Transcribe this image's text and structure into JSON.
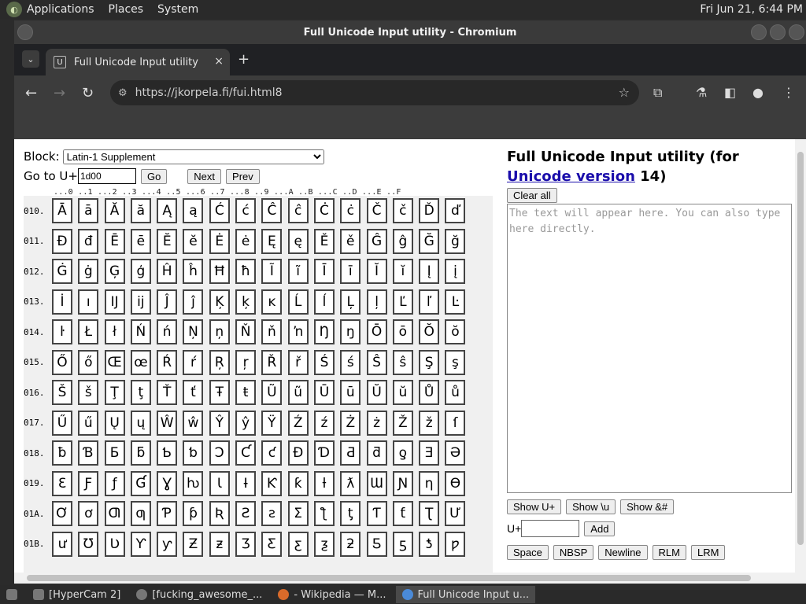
{
  "sysbar": {
    "menus": [
      "Applications",
      "Places",
      "System"
    ],
    "clock": "Fri Jun 21,  6:44 PM"
  },
  "window": {
    "title": "Full Unicode Input utility - Chromium"
  },
  "tab": {
    "title": "Full Unicode Input utility",
    "close": "×",
    "new": "+"
  },
  "omnibox": {
    "url": "https://jkorpela.fi/fui.html8"
  },
  "controls": {
    "block_label": "Block:",
    "block_selected": "Latin-1 Supplement",
    "goto_label": "Go to U+",
    "goto_value": "1d00",
    "go_btn": "Go",
    "next_btn": "Next",
    "prev_btn": "Prev"
  },
  "ruler": "...0 ..1 ...2 ..3 ...4 ..5 ...6 ..7 ...8 ..9 ...A ..B ...C ..D ...E ..F",
  "grid": {
    "rows": [
      {
        "label": "010.",
        "chars": [
          "Ā",
          "ā",
          "Ă",
          "ă",
          "Ą",
          "ą",
          "Ć",
          "ć",
          "Ĉ",
          "ĉ",
          "Ċ",
          "ċ",
          "Č",
          "č",
          "Ď",
          "ď"
        ]
      },
      {
        "label": "011.",
        "chars": [
          "Đ",
          "đ",
          "Ē",
          "ē",
          "Ĕ",
          "ĕ",
          "Ė",
          "ė",
          "Ę",
          "ę",
          "Ě",
          "ě",
          "Ĝ",
          "ĝ",
          "Ğ",
          "ğ"
        ]
      },
      {
        "label": "012.",
        "chars": [
          "Ġ",
          "ġ",
          "Ģ",
          "ģ",
          "Ĥ",
          "ĥ",
          "Ħ",
          "ħ",
          "Ĩ",
          "ĩ",
          "Ī",
          "ī",
          "Ĭ",
          "ĭ",
          "Į",
          "į"
        ]
      },
      {
        "label": "013.",
        "chars": [
          "İ",
          "ı",
          "Ĳ",
          "ĳ",
          "Ĵ",
          "ĵ",
          "Ķ",
          "ķ",
          "ĸ",
          "Ĺ",
          "ĺ",
          "Ļ",
          "ļ",
          "Ľ",
          "ľ",
          "Ŀ"
        ]
      },
      {
        "label": "014.",
        "chars": [
          "ŀ",
          "Ł",
          "ł",
          "Ń",
          "ń",
          "Ņ",
          "ņ",
          "Ň",
          "ň",
          "ŉ",
          "Ŋ",
          "ŋ",
          "Ō",
          "ō",
          "Ŏ",
          "ŏ"
        ]
      },
      {
        "label": "015.",
        "chars": [
          "Ő",
          "ő",
          "Œ",
          "œ",
          "Ŕ",
          "ŕ",
          "Ŗ",
          "ŗ",
          "Ř",
          "ř",
          "Ś",
          "ś",
          "Ŝ",
          "ŝ",
          "Ş",
          "ş"
        ]
      },
      {
        "label": "016.",
        "chars": [
          "Š",
          "š",
          "Ţ",
          "ţ",
          "Ť",
          "ť",
          "Ŧ",
          "ŧ",
          "Ũ",
          "ũ",
          "Ū",
          "ū",
          "Ŭ",
          "ŭ",
          "Ů",
          "ů"
        ]
      },
      {
        "label": "017.",
        "chars": [
          "Ű",
          "ű",
          "Ų",
          "ų",
          "Ŵ",
          "ŵ",
          "Ŷ",
          "ŷ",
          "Ÿ",
          "Ź",
          "ź",
          "Ż",
          "ż",
          "Ž",
          "ž",
          "ſ"
        ]
      },
      {
        "label": "018.",
        "chars": [
          "ƀ",
          "Ɓ",
          "Ƃ",
          "ƃ",
          "Ƅ",
          "ƅ",
          "Ɔ",
          "Ƈ",
          "ƈ",
          "Ɖ",
          "Ɗ",
          "Ƌ",
          "ƌ",
          "ƍ",
          "Ǝ",
          "Ə"
        ]
      },
      {
        "label": "019.",
        "chars": [
          "Ɛ",
          "Ƒ",
          "ƒ",
          "Ɠ",
          "Ɣ",
          "ƕ",
          "Ɩ",
          "Ɨ",
          "Ƙ",
          "ƙ",
          "ƚ",
          "ƛ",
          "Ɯ",
          "Ɲ",
          "ƞ",
          "Ɵ"
        ]
      },
      {
        "label": "01A.",
        "chars": [
          "Ơ",
          "ơ",
          "Ƣ",
          "ƣ",
          "Ƥ",
          "ƥ",
          "Ʀ",
          "Ƨ",
          "ƨ",
          "Ʃ",
          "ƪ",
          "ƫ",
          "Ƭ",
          "ƭ",
          "Ʈ",
          "Ư"
        ]
      },
      {
        "label": "01B.",
        "chars": [
          "ư",
          "Ʊ",
          "Ʋ",
          "Ƴ",
          "ƴ",
          "Ƶ",
          "ƶ",
          "Ʒ",
          "Ƹ",
          "ƹ",
          "ƺ",
          "ƻ",
          "Ƽ",
          "ƽ",
          "ƾ",
          "ƿ"
        ]
      }
    ]
  },
  "right": {
    "title_pre": "Full Unicode Input utility (for ",
    "title_link": "Unicode version",
    "title_post": " 14)",
    "clear_btn": "Clear all",
    "textarea_placeholder": "The text will appear here. You can also type here directly.",
    "show_u_btn": "Show U+",
    "show_bs_u_btn": "Show \\u",
    "show_amp_btn": "Show &#",
    "uplus_label": "U+",
    "add_btn": "Add",
    "space_btn": "Space",
    "nbsp_btn": "NBSP",
    "newline_btn": "Newline",
    "rlm_btn": "RLM",
    "lrm_btn": "LRM"
  },
  "taskbar": {
    "items": [
      "[HyperCam 2]",
      "[fucking_awesome_...",
      "- Wikipedia — M...",
      "Full Unicode Input u..."
    ]
  }
}
